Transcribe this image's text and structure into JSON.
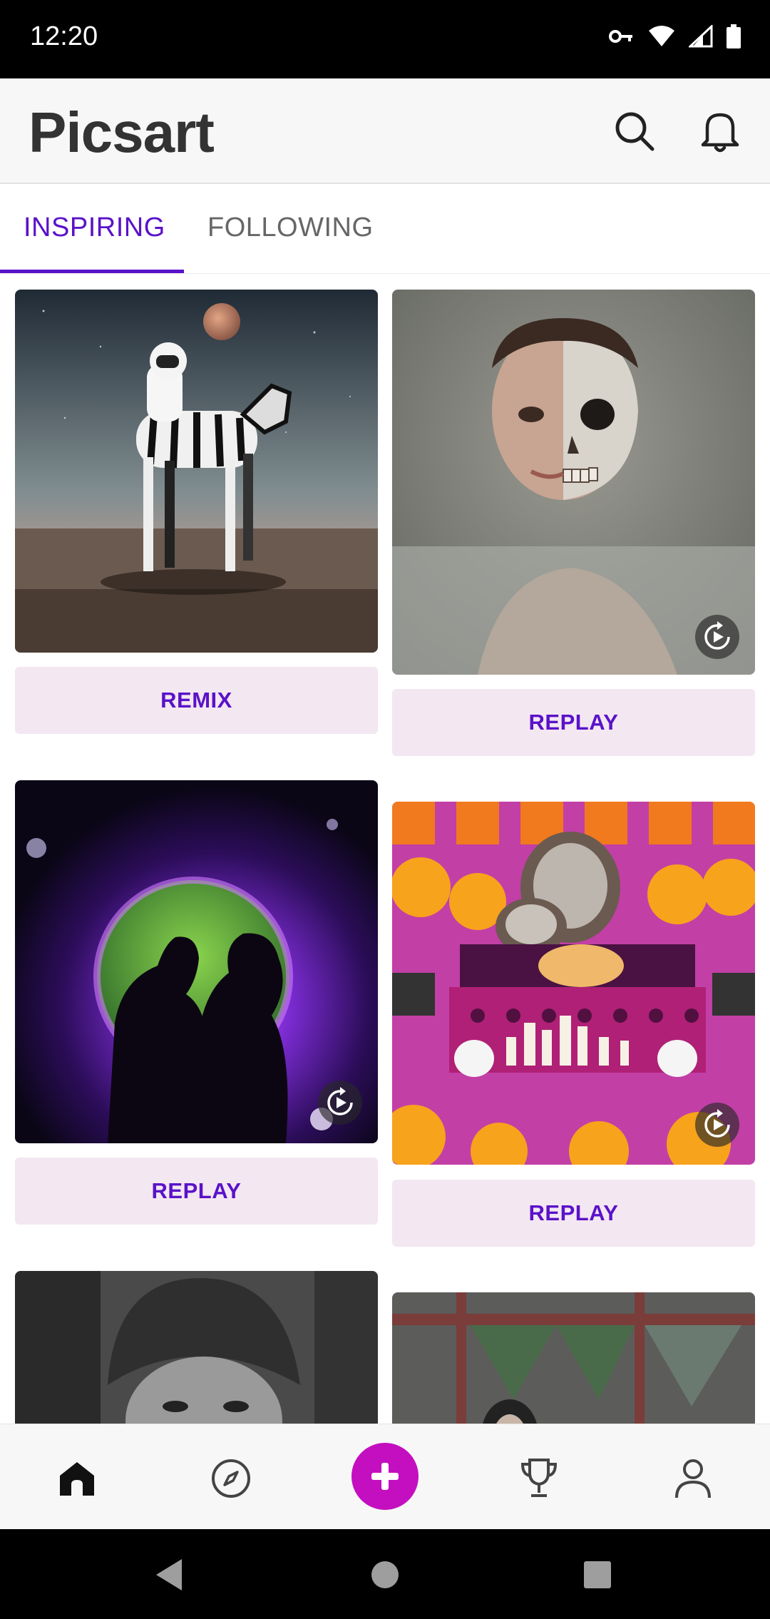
{
  "status_bar": {
    "time": "12:20"
  },
  "app_bar": {
    "logo_text": "Picsart",
    "icons": [
      "search-icon",
      "bell-icon"
    ]
  },
  "tabs": [
    {
      "label": "INSPIRING",
      "active": true
    },
    {
      "label": "FOLLOWING",
      "active": false
    }
  ],
  "feed": {
    "cards": [
      {
        "image": "astronaut-riding-zebra",
        "button_label": "REMIX",
        "replay_badge": false
      },
      {
        "image": "half-skull-portrait",
        "button_label": "REPLAY",
        "replay_badge": true
      },
      {
        "image": "silhouette-couple-planet",
        "button_label": "REPLAY",
        "replay_badge": true
      },
      {
        "image": "day-of-the-dead-altar",
        "button_label": "REPLAY",
        "replay_badge": true
      },
      {
        "image": "woman-fur-hat",
        "button_label": null,
        "replay_badge": false
      },
      {
        "image": "window-banner-woman",
        "button_label": null,
        "replay_badge": false
      }
    ]
  },
  "bottom_nav": {
    "items": [
      "home-icon",
      "explore-icon",
      "create-icon",
      "trophy-icon",
      "profile-icon"
    ],
    "active": "home-icon"
  },
  "colors": {
    "accent": "#5a12c9",
    "create": "#c40fc0",
    "button_bg": "#f3e7f1"
  }
}
